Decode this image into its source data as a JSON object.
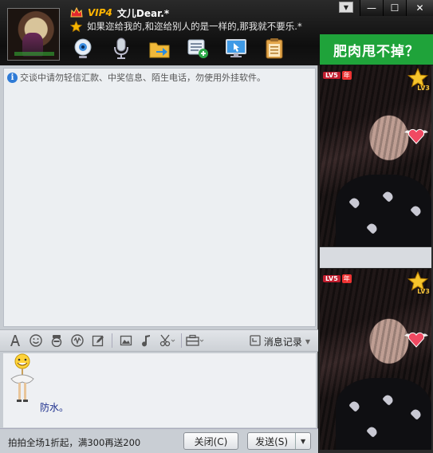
{
  "contact": {
    "vip_level": "VIP4",
    "nickname": "文儿Dear.*",
    "signature": "如果迩给我的,和迩给别人的是一样的,那我就不要乐.*"
  },
  "toolbar": {
    "icons": [
      "webcam-icon",
      "microphone-icon",
      "file-transfer-icon",
      "group-add-icon",
      "remote-desktop-icon",
      "notepad-icon"
    ]
  },
  "window": {
    "menu_symbol": "▼",
    "minimize_symbol": "—",
    "maximize_symbol": "☐",
    "close_symbol": "✕"
  },
  "ad": {
    "text": "肥肉甩不掉？"
  },
  "chat": {
    "notice": "交谈中请勿轻信汇款、中奖信息、陌生电话，勿使用外挂软件。",
    "history_label": "消息记录",
    "input_text": "防水。"
  },
  "bottom": {
    "promo": "拍拍全场1折起，满300再送200",
    "close_label": "关闭(C)",
    "send_label": "发送(S)"
  },
  "side": {
    "level_badge": "LV5",
    "year_badge": "年",
    "level_num": "LV3"
  },
  "colors": {
    "header_bg": "#111111",
    "vip": "#ffb400",
    "ad_bg": "#1fa33a",
    "input_text": "#1c2e8c"
  }
}
